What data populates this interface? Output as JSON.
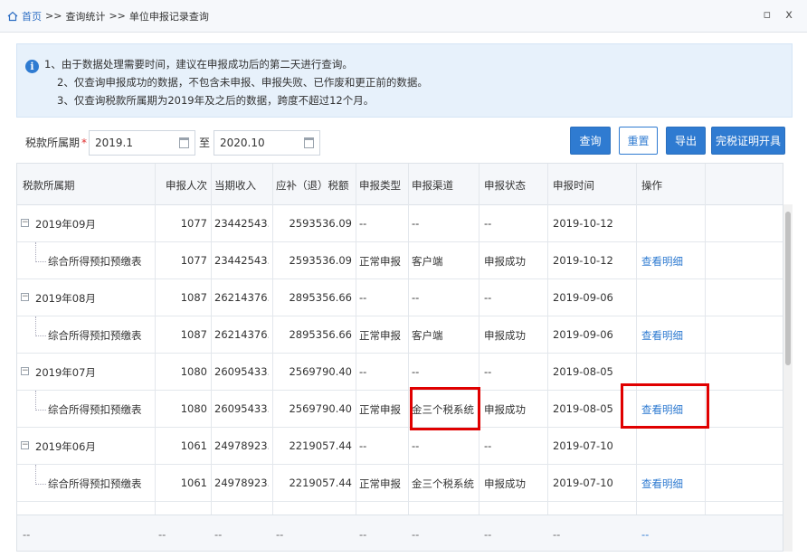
{
  "breadcrumb": {
    "home": "首页",
    "separator": ">>",
    "items": [
      "查询统计",
      "单位申报记录查询"
    ],
    "window_controls": "▫ x"
  },
  "notice": {
    "icon": "info-icon",
    "lines": [
      "1、由于数据处理需要时间，建议在申报成功后的第二天进行查询。",
      "2、仅查询申报成功的数据，不包含未申报、申报失败、已作废和更正前的数据。",
      "3、仅查询税款所属期为2019年及之后的数据，跨度不超过12个月。"
    ]
  },
  "filter": {
    "label": "税款所属期",
    "required_mark": "*",
    "start": "2019.1",
    "to": "至",
    "end": "2020.10"
  },
  "buttons": {
    "query": "查询",
    "reset": "重置",
    "export": "导出",
    "certificate": "完税证明开具"
  },
  "table": {
    "headers": [
      "税款所属期",
      "申报人次",
      "当期收入",
      "应补（退）税额",
      "申报类型",
      "申报渠道",
      "申报状态",
      "申报时间",
      "操作"
    ],
    "rows": [
      {
        "type": "group",
        "period": "2019年09月",
        "count": "1077",
        "income": "23442543...",
        "tax": "2593536.09",
        "dtype": "--",
        "channel": "--",
        "status": "--",
        "time": "2019-10-12",
        "op": ""
      },
      {
        "type": "child",
        "period": "综合所得预扣预缴表",
        "count": "1077",
        "income": "23442543...",
        "tax": "2593536.09",
        "dtype": "正常申报",
        "channel": "客户端",
        "status": "申报成功",
        "time": "2019-10-12",
        "op": "查看明细"
      },
      {
        "type": "group",
        "period": "2019年08月",
        "count": "1087",
        "income": "26214376...",
        "tax": "2895356.66",
        "dtype": "--",
        "channel": "--",
        "status": "--",
        "time": "2019-09-06",
        "op": ""
      },
      {
        "type": "child",
        "period": "综合所得预扣预缴表",
        "count": "1087",
        "income": "26214376...",
        "tax": "2895356.66",
        "dtype": "正常申报",
        "channel": "客户端",
        "status": "申报成功",
        "time": "2019-09-06",
        "op": "查看明细"
      },
      {
        "type": "group",
        "period": "2019年07月",
        "count": "1080",
        "income": "26095433...",
        "tax": "2569790.40",
        "dtype": "--",
        "channel": "--",
        "status": "--",
        "time": "2019-08-05",
        "op": ""
      },
      {
        "type": "child",
        "period": "综合所得预扣预缴表",
        "count": "1080",
        "income": "26095433...",
        "tax": "2569790.40",
        "dtype": "正常申报",
        "channel": "金三个税系统",
        "status": "申报成功",
        "time": "2019-08-05",
        "op": "查看明细"
      },
      {
        "type": "group",
        "period": "2019年06月",
        "count": "1061",
        "income": "24978923...",
        "tax": "2219057.44",
        "dtype": "--",
        "channel": "--",
        "status": "--",
        "time": "2019-07-10",
        "op": ""
      },
      {
        "type": "child",
        "period": "综合所得预扣预缴表",
        "count": "1061",
        "income": "24978923...",
        "tax": "2219057.44",
        "dtype": "正常申报",
        "channel": "金三个税系统",
        "status": "申报成功",
        "time": "2019-07-10",
        "op": "查看明细"
      }
    ],
    "footer": [
      "--",
      "--",
      "--",
      "--",
      "--",
      "--",
      "--",
      "--",
      "--"
    ]
  },
  "colors": {
    "accent": "#2f7bd1",
    "highlight": "#e00000"
  }
}
